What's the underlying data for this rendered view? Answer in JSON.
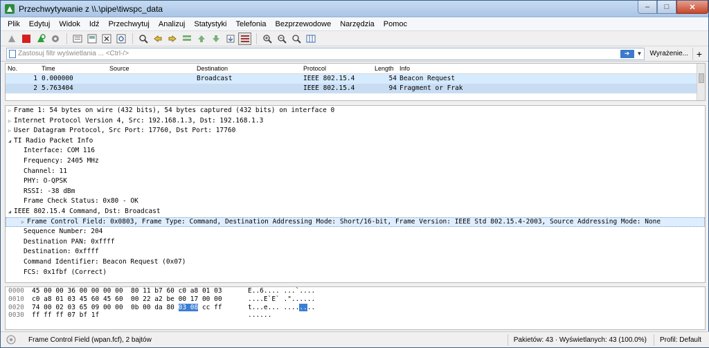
{
  "window": {
    "title": "Przechwytywanie z \\\\.\\pipe\\tiwspc_data",
    "minimize": "–",
    "maximize": "□",
    "close": "✕"
  },
  "menu": [
    "Plik",
    "Edytuj",
    "Widok",
    "Idź",
    "Przechwytuj",
    "Analizuj",
    "Statystyki",
    "Telefonia",
    "Bezprzewodowe",
    "Narzędzia",
    "Pomoc"
  ],
  "filter": {
    "placeholder": "Zastosuj filtr wyświetlania ... <Ctrl-/>",
    "expression_label": "Wyrażenie...",
    "add_label": "+"
  },
  "packet_list": {
    "columns": [
      "No.",
      "Time",
      "Source",
      "Destination",
      "Protocol",
      "Length",
      "Info"
    ],
    "rows": [
      {
        "no": "1",
        "time": "0.000000",
        "source": "",
        "destination": "Broadcast",
        "protocol": "IEEE 802.15.4",
        "length": "54",
        "info": "Beacon Request"
      },
      {
        "no": "2",
        "time": "5.763404",
        "source": "",
        "destination": "",
        "protocol": "IEEE 802.15.4",
        "length": "94",
        "info": "Fragment or Frak"
      }
    ]
  },
  "details": {
    "frame": "Frame 1: 54 bytes on wire (432 bits), 54 bytes captured (432 bits) on interface 0",
    "ip": "Internet Protocol Version 4, Src: 192.168.1.3, Dst: 192.168.1.3",
    "udp": "User Datagram Protocol, Src Port: 17760, Dst Port: 17760",
    "ti": "TI Radio Packet Info",
    "ti_fields": [
      "Interface: COM 116",
      "Frequency: 2405 MHz",
      "Channel: 11",
      "PHY: O-QPSK",
      "RSSI: -38 dBm",
      "Frame Check Status: 0x80 - OK"
    ],
    "ieee": "IEEE 802.15.4 Command, Dst: Broadcast",
    "ieee_fcf": "Frame Control Field: 0x0803, Frame Type: Command, Destination Addressing Mode: Short/16-bit, Frame Version: IEEE Std 802.15.4-2003, Source Addressing Mode: None",
    "ieee_fields": [
      "Sequence Number: 204",
      "Destination PAN: 0xffff",
      "Destination: 0xffff",
      "Command Identifier: Beacon Request (0x07)",
      "FCS: 0x1fbf (Correct)"
    ]
  },
  "hex": {
    "rows": [
      {
        "offset": "0000",
        "bytes": "45 00 00 36 00 00 00 00  80 11 b7 60 c0 a8 01 03",
        "ascii": "E..6.... ...`...."
      },
      {
        "offset": "0010",
        "bytes": "c0 a8 01 03 45 60 45 60  00 22 a2 be 00 17 00 00",
        "ascii": "....E`E` .\"......"
      },
      {
        "offset": "0020",
        "bytes_pre": "74 00 02 03 65 09 00 00  0b 00 da 80 ",
        "bytes_hl": "03 08",
        "bytes_post": " cc ff",
        "ascii_pre": "t...e... ....",
        "ascii_hl": "..",
        "ascii_post": ".."
      },
      {
        "offset": "0030",
        "bytes": "ff ff ff 07 bf 1f",
        "ascii": "......"
      }
    ]
  },
  "status": {
    "field": "Frame Control Field (wpan.fcf), 2 bajtów",
    "packets": "Pakietów: 43 · Wyświetlanych: 43 (100.0%)",
    "profile": "Profil: Default"
  },
  "colors": {
    "selected_row": "#c8ddf2",
    "hex_highlight": "#3b7fd4"
  }
}
